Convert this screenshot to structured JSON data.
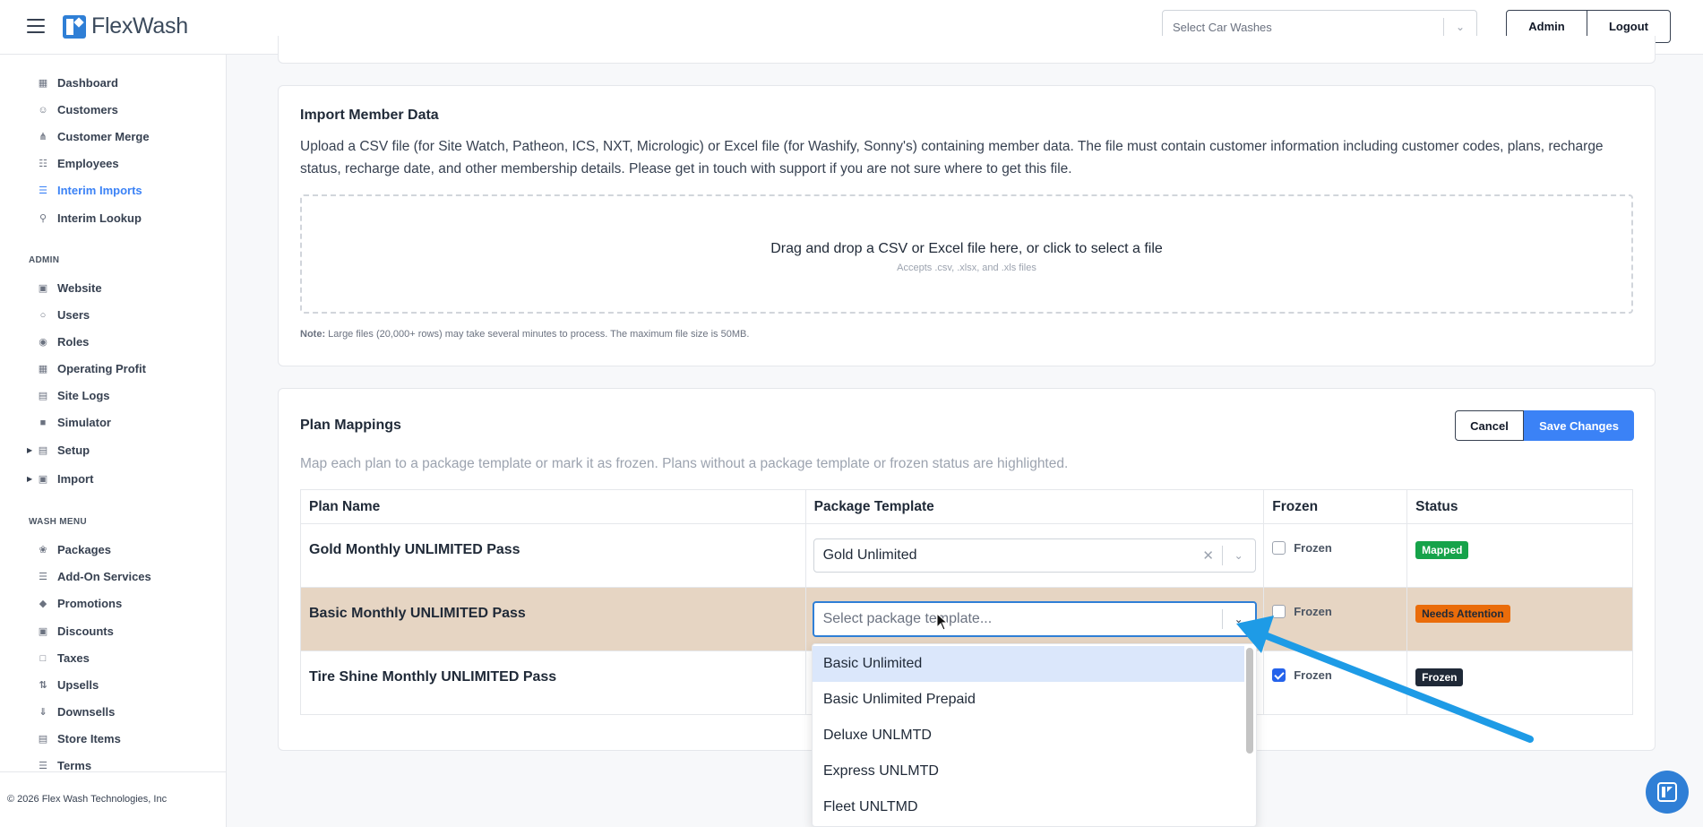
{
  "header": {
    "logo_text": "FlexWash",
    "car_wash_select_placeholder": "Select Car Washes",
    "admin_button": "Admin",
    "logout_button": "Logout"
  },
  "sidebar": {
    "items": [
      {
        "label": "Dashboard",
        "icon": "dashboard-icon"
      },
      {
        "label": "Customers",
        "icon": "customers-icon"
      },
      {
        "label": "Customer Merge",
        "icon": "merge-icon"
      },
      {
        "label": "Employees",
        "icon": "employees-icon"
      },
      {
        "label": "Interim Imports",
        "icon": "imports-icon",
        "active": true
      },
      {
        "label": "Interim Lookup",
        "icon": "lookup-icon"
      }
    ],
    "admin_heading": "ADMIN",
    "admin_items": [
      {
        "label": "Website",
        "icon": "website-icon"
      },
      {
        "label": "Users",
        "icon": "users-icon"
      },
      {
        "label": "Roles",
        "icon": "roles-icon"
      },
      {
        "label": "Operating Profit",
        "icon": "calculator-icon"
      },
      {
        "label": "Site Logs",
        "icon": "logs-icon"
      },
      {
        "label": "Simulator",
        "icon": "simulator-icon"
      },
      {
        "label": "Setup",
        "icon": "setup-icon"
      },
      {
        "label": "Import",
        "icon": "import-icon"
      }
    ],
    "wash_menu_heading": "WASH MENU",
    "wash_items": [
      {
        "label": "Packages",
        "icon": "packages-icon"
      },
      {
        "label": "Add-On Services",
        "icon": "addon-icon"
      },
      {
        "label": "Promotions",
        "icon": "promotions-icon"
      },
      {
        "label": "Discounts",
        "icon": "discounts-icon"
      },
      {
        "label": "Taxes",
        "icon": "taxes-icon"
      },
      {
        "label": "Upsells",
        "icon": "upsells-icon"
      },
      {
        "label": "Downsells",
        "icon": "downsells-icon"
      },
      {
        "label": "Store Items",
        "icon": "store-icon"
      },
      {
        "label": "Terms",
        "icon": "terms-icon"
      }
    ],
    "footer": "© 2026 Flex Wash Technologies, Inc"
  },
  "import_card": {
    "title": "Import Member Data",
    "description": "Upload a CSV file (for Site Watch, Patheon, ICS, NXT, Micrologic) or Excel file (for Washify, Sonny's) containing member data. The file must contain customer information including customer codes, plans, recharge status, recharge date, and other membership details. Please get in touch with support if you are not sure where to get this file.",
    "dropzone_main": "Drag and drop a CSV or Excel file here, or click to select a file",
    "dropzone_sub": "Accepts .csv, .xlsx, and .xls files",
    "note_label": "Note:",
    "note_text": " Large files (20,000+ rows) may take several minutes to process. The maximum file size is 50MB."
  },
  "plan_mappings": {
    "title": "Plan Mappings",
    "cancel_button": "Cancel",
    "save_button": "Save Changes",
    "description": "Map each plan to a package template or mark it as frozen. Plans without a package template or frozen status are highlighted.",
    "columns": [
      "Plan Name",
      "Package Template",
      "Frozen",
      "Status"
    ],
    "rows": [
      {
        "plan": "Gold Monthly UNLIMITED Pass",
        "template": "Gold Unlimited",
        "frozen_label": "Frozen",
        "frozen": false,
        "status": "Mapped"
      },
      {
        "plan": "Basic Monthly UNLIMITED Pass",
        "template_placeholder": "Select package template...",
        "frozen_label": "Frozen",
        "frozen": false,
        "status": "Needs Attention"
      },
      {
        "plan": "Tire Shine Monthly UNLIMITED Pass",
        "template": "",
        "frozen_label": "Frozen",
        "frozen": true,
        "status": "Frozen"
      }
    ],
    "dropdown_options": [
      "Basic Unlimited",
      "Basic Unlimited Prepaid",
      "Deluxe UNLMTD",
      "Express UNLMTD",
      "Fleet UNLTMD"
    ]
  },
  "colors": {
    "accent": "#3b82f6",
    "mapped": "#16a34a",
    "needs_attention": "#ea6c0a",
    "frozen_badge": "#1f2937",
    "attention_row": "#e6d5c3",
    "annotation_arrow": "#1e9be6"
  }
}
